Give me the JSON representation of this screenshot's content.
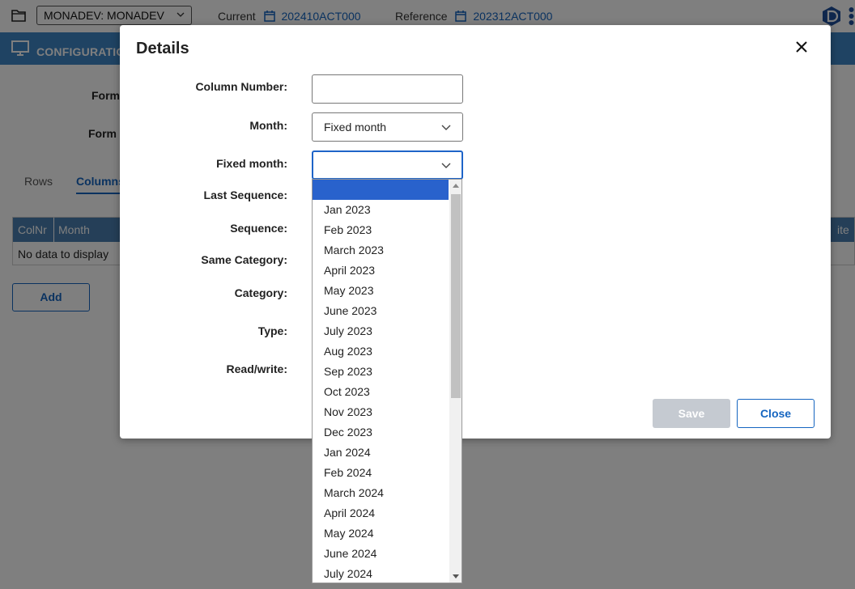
{
  "topbar": {
    "environment": "MONADEV: MONADEV",
    "current_label": "Current",
    "current_value": "202410ACT000",
    "reference_label": "Reference",
    "reference_value": "202312ACT000"
  },
  "config_bar": {
    "title": "CONFIGURATIO"
  },
  "background": {
    "form_label_1": "Form",
    "form_label_2": "Form N",
    "tabs": [
      "Rows",
      "Columns"
    ],
    "grid_headers": [
      "ColNr",
      "Month",
      "ite"
    ],
    "grid_empty": "No data to display",
    "add_label": "Add"
  },
  "dialog": {
    "title": "Details",
    "labels": {
      "column_number": "Column Number:",
      "month": "Month:",
      "fixed_month": "Fixed month:",
      "last_sequence": "Last Sequence:",
      "sequence": "Sequence:",
      "same_category": "Same Category:",
      "category": "Category:",
      "type": "Type:",
      "read_write": "Read/write:"
    },
    "column_number_value": "",
    "month_value": "Fixed month",
    "fixed_month_value": "",
    "save_label": "Save",
    "close_label": "Close"
  },
  "fixed_month_options": [
    "",
    "Jan 2023",
    "Feb 2023",
    "March 2023",
    "April 2023",
    "May 2023",
    "June 2023",
    "July 2023",
    "Aug 2023",
    "Sep 2023",
    "Oct 2023",
    "Nov 2023",
    "Dec 2023",
    "Jan 2024",
    "Feb 2024",
    "March 2024",
    "April 2024",
    "May 2024",
    "June 2024",
    "July 2024"
  ],
  "colors": {
    "accent": "#1565c0",
    "header_bar": "#3f86c6",
    "selected_option": "#2962cc"
  }
}
